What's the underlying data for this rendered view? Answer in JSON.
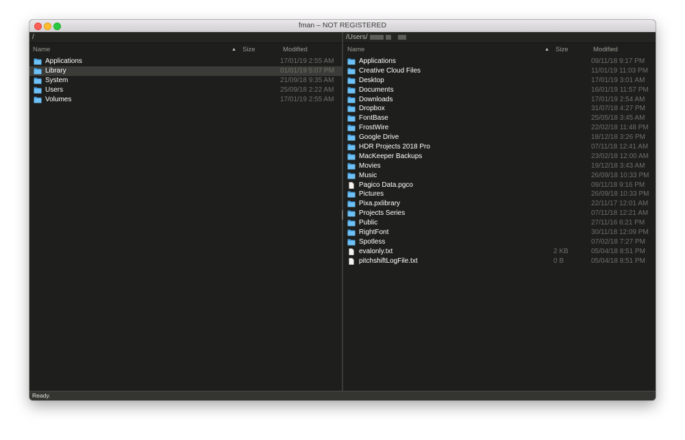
{
  "window": {
    "title": "fman – NOT REGISTERED"
  },
  "status": "Ready.",
  "columns": {
    "name": "Name",
    "size": "Size",
    "modified": "Modified",
    "sort_indicator": "▲"
  },
  "left_pane": {
    "path": "/",
    "files": [
      {
        "name": "Applications",
        "type": "folder",
        "icon": "folder-icon",
        "size": "",
        "modified": "17/01/19 2:55 AM"
      },
      {
        "name": "Library",
        "type": "folder",
        "icon": "folder-icon",
        "size": "",
        "modified": "01/01/19 5:07 PM",
        "selected": true
      },
      {
        "name": "System",
        "type": "folder",
        "icon": "folder-icon",
        "size": "",
        "modified": "21/09/18 9:35 AM"
      },
      {
        "name": "Users",
        "type": "folder",
        "icon": "folder-icon",
        "size": "",
        "modified": "25/09/18 2:22 AM"
      },
      {
        "name": "Volumes",
        "type": "folder",
        "icon": "folder-icon",
        "size": "",
        "modified": "17/01/19 2:55 AM"
      }
    ]
  },
  "right_pane": {
    "path": "/Users/",
    "files": [
      {
        "name": "Applications",
        "type": "folder",
        "icon": "folder-icon",
        "size": "",
        "modified": "09/11/18 9:17 PM"
      },
      {
        "name": "Creative Cloud Files",
        "type": "folder",
        "icon": "folder-icon",
        "size": "",
        "modified": "11/01/19 11:03 PM"
      },
      {
        "name": "Desktop",
        "type": "folder",
        "icon": "folder-icon",
        "size": "",
        "modified": "17/01/19 3:01 AM"
      },
      {
        "name": "Documents",
        "type": "folder",
        "icon": "folder-icon",
        "size": "",
        "modified": "16/01/19 11:57 PM"
      },
      {
        "name": "Downloads",
        "type": "folder",
        "icon": "folder-icon",
        "size": "",
        "modified": "17/01/19 2:54 AM"
      },
      {
        "name": "Dropbox",
        "type": "folder",
        "icon": "folder-icon",
        "size": "",
        "modified": "31/07/18 4:27 PM"
      },
      {
        "name": "FontBase",
        "type": "folder",
        "icon": "folder-icon",
        "size": "",
        "modified": "25/05/18 3:45 AM"
      },
      {
        "name": "FrostWire",
        "type": "folder",
        "icon": "folder-icon",
        "size": "",
        "modified": "22/02/18 11:48 PM"
      },
      {
        "name": "Google Drive",
        "type": "folder",
        "icon": "folder-icon",
        "size": "",
        "modified": "18/12/18 3:26 PM"
      },
      {
        "name": "HDR Projects 2018 Pro",
        "type": "folder",
        "icon": "folder-icon",
        "size": "",
        "modified": "07/11/18 12:41 AM"
      },
      {
        "name": "MacKeeper Backups",
        "type": "folder",
        "icon": "folder-icon",
        "size": "",
        "modified": "23/02/18 12:00 AM"
      },
      {
        "name": "Movies",
        "type": "folder",
        "icon": "folder-icon",
        "size": "",
        "modified": "19/12/18 3:43 AM"
      },
      {
        "name": "Music",
        "type": "folder",
        "icon": "folder-icon",
        "size": "",
        "modified": "26/09/18 10:33 PM"
      },
      {
        "name": "Pagico Data.pgco",
        "type": "file",
        "icon": "file-icon",
        "size": "",
        "modified": "09/11/18 9:16 PM"
      },
      {
        "name": "Pictures",
        "type": "folder",
        "icon": "folder-icon",
        "size": "",
        "modified": "26/09/18 10:33 PM"
      },
      {
        "name": "Pixa.pxlibrary",
        "type": "folder",
        "icon": "folder-icon",
        "size": "",
        "modified": "22/11/17 12:01 AM"
      },
      {
        "name": "Projects Series",
        "type": "folder",
        "icon": "folder-icon",
        "size": "",
        "modified": "07/11/18 12:21 AM"
      },
      {
        "name": "Public",
        "type": "folder",
        "icon": "folder-icon",
        "size": "",
        "modified": "27/11/16 6:21 PM"
      },
      {
        "name": "RightFont",
        "type": "folder",
        "icon": "folder-icon",
        "size": "",
        "modified": "30/11/18 12:09 PM"
      },
      {
        "name": "Spotless",
        "type": "folder",
        "icon": "folder-icon",
        "size": "",
        "modified": "07/02/18 7:27 PM"
      },
      {
        "name": "evalonly.txt",
        "type": "file",
        "icon": "file-icon",
        "size": "2 KB",
        "modified": "05/04/18 8:51 PM"
      },
      {
        "name": "pitchshiftLogFile.txt",
        "type": "file",
        "icon": "file-icon",
        "size": "0 B",
        "modified": "05/04/18 8:51 PM"
      }
    ]
  },
  "colors": {
    "background": "#1e1f1c",
    "folder": "#5fb3f0",
    "selection": "#3b3c37",
    "text": "#ffffff",
    "muted_text": "#6f6f6a"
  }
}
